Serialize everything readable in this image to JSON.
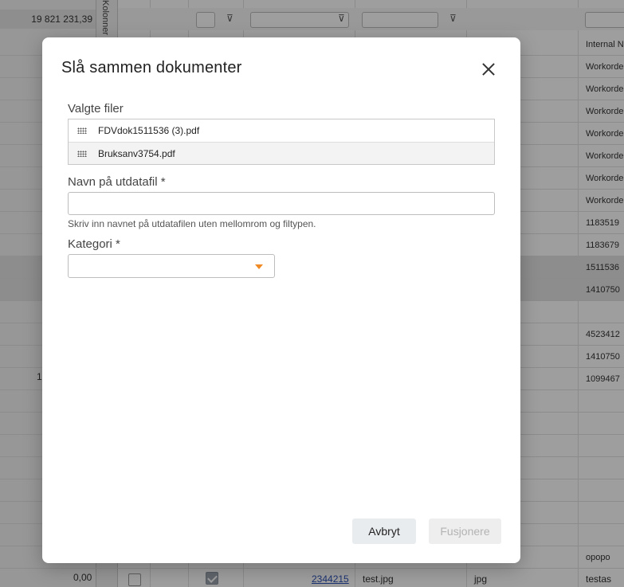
{
  "background": {
    "sum_value": "19 821 231,39",
    "sidebar_label": "Kolonner",
    "right_column_cells": [
      "Internal N",
      "Workorde",
      "Workorde",
      "Workorde",
      "Workorde",
      "Workorde",
      "Workorde",
      "Workorde",
      "1183519",
      "1183679",
      "1511536",
      "1410750",
      "",
      "4523412",
      "1410750",
      "1099467",
      "",
      "",
      "",
      "",
      "",
      "",
      "",
      "opopo"
    ],
    "left_partial_value": "1",
    "bottom_row": {
      "amount": "0,00",
      "doc_id": "2344215",
      "file_name": "test.jpg",
      "file_type": "jpg",
      "extra": "testas"
    }
  },
  "dialog": {
    "title": "Slå sammen dokumenter",
    "close_icon": "close-icon",
    "selected_files_label": "Valgte filer",
    "files": [
      {
        "name": "FDVdok1511536 (3).pdf"
      },
      {
        "name": "Bruksanv3754.pdf"
      }
    ],
    "output_name_label": "Navn på utdatafil *",
    "output_name_value": "",
    "output_name_help": "Skriv inn navnet på utdatafilen uten mellomrom og filtypen.",
    "category_label": "Kategori *",
    "category_value": "",
    "cancel_label": "Avbryt",
    "merge_label": "Fusjonere"
  },
  "colors": {
    "accent": "#f08a24",
    "overlay": "rgba(0,0,0,0.38)"
  }
}
